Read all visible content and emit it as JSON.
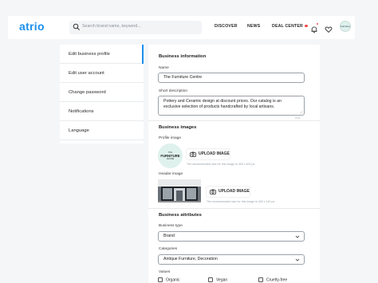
{
  "header": {
    "logo": "atrio",
    "search_placeholder": "Search brand name, keyword...",
    "nav": {
      "discover": "DISCOVER",
      "news": "NEWS",
      "deal_center": "DEAL CENTER"
    },
    "avatar_text": "Furniture"
  },
  "sidebar": {
    "items": [
      {
        "label": "Edit business profile",
        "active": true
      },
      {
        "label": "Edit user account"
      },
      {
        "label": "Change password"
      },
      {
        "label": "Notifications"
      },
      {
        "label": "Language"
      }
    ]
  },
  "form": {
    "business_info_title": "Business information",
    "name_label": "Name",
    "name_value": "The Furniture Centre",
    "short_desc_label": "Short description",
    "short_desc_value": "Pottery and Ceramic design at discount prices. Our catalog is an exclusive selection of products handcrafted by local artisans.",
    "short_desc_counter": "214",
    "business_images_title": "Business images",
    "profile_image_label": "Profile image",
    "profile_logo": {
      "line1": "THE",
      "line2": "FURNITURE",
      "line3": "CENTRE"
    },
    "upload_label": "UPLOAD IMAGE",
    "profile_hint": "The recommended size for this image is 400 x 400 px.",
    "header_image_label": "Header image",
    "header_hint": "The recommended size for this image is 400 x 140 px.",
    "business_attributes_title": "Business attributes",
    "business_type_label": "Business type",
    "business_type_value": "Brand",
    "categories_label": "Categories",
    "categories_value": "Antique Furniture, Decoration",
    "values_label": "Values",
    "values_options": [
      "Organic",
      "Vegan",
      "Cruelty-free"
    ]
  },
  "colors": {
    "accent": "#1a90ee",
    "notification": "#ef4b4b",
    "avatar_bg": "#dff1ec"
  },
  "icons": [
    "search-icon",
    "bell-icon",
    "heart-icon",
    "camera-icon",
    "chevron-down-icon",
    "resize-icon"
  ]
}
